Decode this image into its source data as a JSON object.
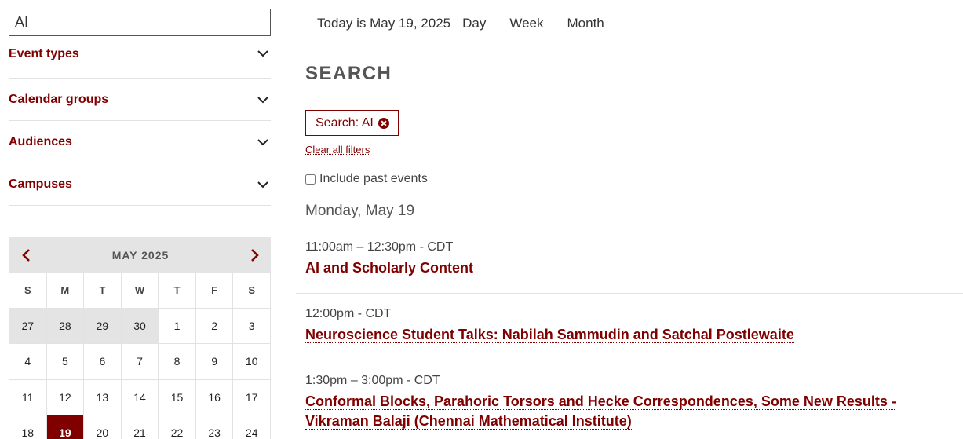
{
  "search": {
    "value": "AI"
  },
  "filters": [
    {
      "label": "Event types"
    },
    {
      "label": "Calendar groups"
    },
    {
      "label": "Audiences"
    },
    {
      "label": "Campuses"
    }
  ],
  "mini_calendar": {
    "month_label": "MAY 2025",
    "weekdays": [
      "S",
      "M",
      "T",
      "W",
      "T",
      "F",
      "S"
    ],
    "weeks": [
      [
        {
          "d": "27",
          "prev": true
        },
        {
          "d": "28",
          "prev": true
        },
        {
          "d": "29",
          "prev": true
        },
        {
          "d": "30",
          "prev": true
        },
        {
          "d": "1"
        },
        {
          "d": "2"
        },
        {
          "d": "3"
        }
      ],
      [
        {
          "d": "4"
        },
        {
          "d": "5"
        },
        {
          "d": "6"
        },
        {
          "d": "7"
        },
        {
          "d": "8"
        },
        {
          "d": "9"
        },
        {
          "d": "10"
        }
      ],
      [
        {
          "d": "11"
        },
        {
          "d": "12"
        },
        {
          "d": "13"
        },
        {
          "d": "14"
        },
        {
          "d": "15"
        },
        {
          "d": "16"
        },
        {
          "d": "17"
        }
      ],
      [
        {
          "d": "18"
        },
        {
          "d": "19",
          "today": true
        },
        {
          "d": "20"
        },
        {
          "d": "21"
        },
        {
          "d": "22"
        },
        {
          "d": "23"
        },
        {
          "d": "24"
        }
      ]
    ]
  },
  "nav": {
    "today_text": "Today is May 19, 2025",
    "day": "Day",
    "week": "Week",
    "month": "Month"
  },
  "page_title": "SEARCH",
  "chip_label": "Search: AI",
  "clear_filters": "Clear all filters",
  "include_past": "Include past events",
  "day_heading": "Monday, May 19",
  "events": [
    {
      "time": "11:00am – 12:30pm - CDT",
      "title": "AI and Scholarly Content"
    },
    {
      "time": "12:00pm - CDT",
      "title": "Neuroscience Student Talks: Nabilah Sammudin and Satchal Postlewaite"
    },
    {
      "time": "1:30pm – 3:00pm - CDT",
      "title": "Conformal Blocks, Parahoric Torsors and Hecke Correspondences, Some New Results - Vikraman Balaji (Chennai Mathematical Institute)"
    }
  ],
  "colors": {
    "accent": "#800000",
    "muted_bg": "#e4e4e4",
    "divider": "#e2e2e2"
  }
}
